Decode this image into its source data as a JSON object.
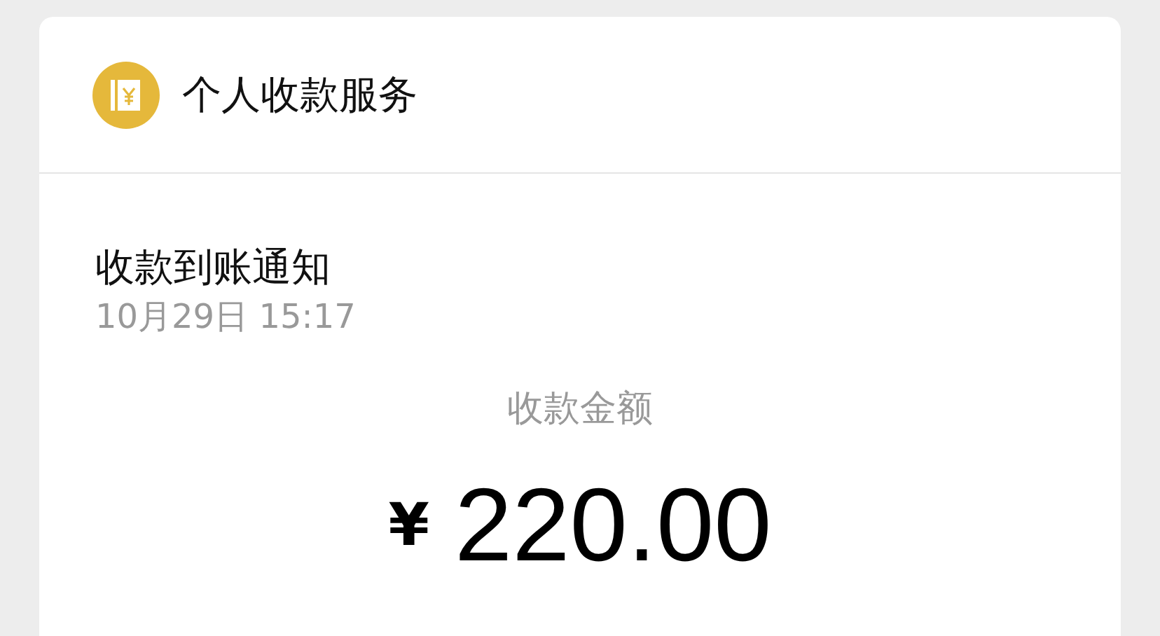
{
  "header": {
    "title": "个人收款服务"
  },
  "notice": {
    "title": "收款到账通知",
    "time": "10月29日 15:17"
  },
  "amount": {
    "label": "收款金额",
    "currency": "¥",
    "value": "220.00"
  }
}
